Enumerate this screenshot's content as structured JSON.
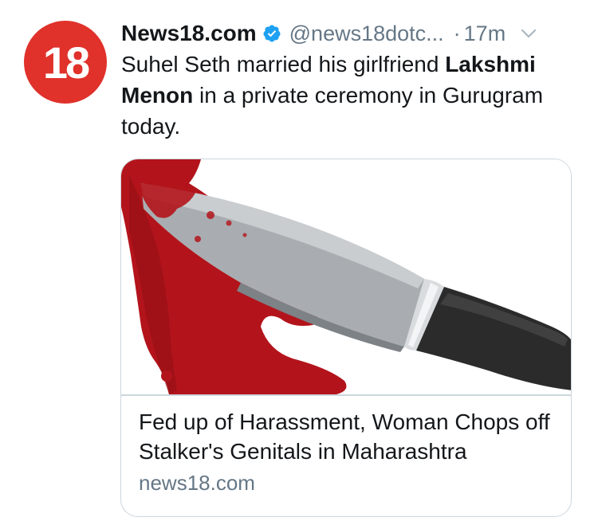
{
  "account": {
    "avatar_text": "18",
    "display_name": "News18.com",
    "handle": "@news18dotc...",
    "separator": "·",
    "time": "17m",
    "verified_icon": "verified-badge-icon",
    "menu_icon": "chevron-down-icon"
  },
  "tweet": {
    "text_before": "Suhel Seth married his girlfriend ",
    "mention": "Lakshmi Menon",
    "text_after": " in a private ceremony in Gurugram today."
  },
  "card": {
    "image_subject": "bloody-knife-image",
    "title": "Fed up of Harassment, Woman Chops off Stalker's Genitals in Maharashtra",
    "domain": "news18.com"
  },
  "colors": {
    "avatar_bg": "#e0312b",
    "verified_blue": "#1da1f2",
    "secondary_text": "#657786",
    "primary_text": "#14171a",
    "card_border": "#ccd6dd",
    "blood": "#b3141b"
  }
}
